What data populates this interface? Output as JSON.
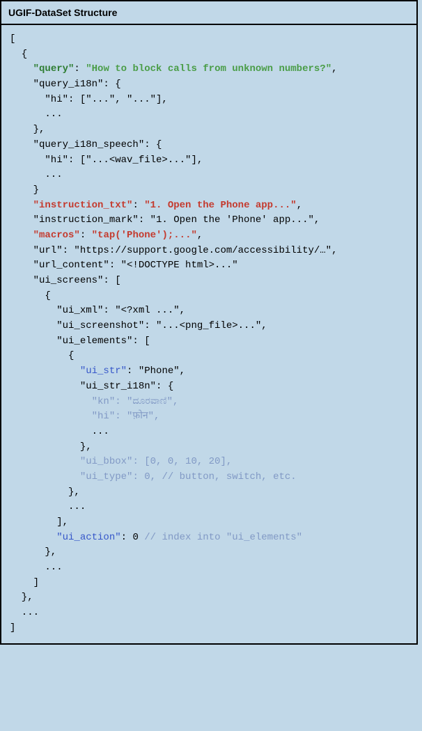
{
  "header": {
    "title": "UGIF-DataSet Structure"
  },
  "code": {
    "l1": "[",
    "l2": "  {",
    "l3a": "    ",
    "l3b": "\"query\"",
    "l3c": ": ",
    "l3d": "\"How to block calls from unknown numbers?\"",
    "l3e": ",",
    "l4": "    \"query_i18n\": {",
    "l5": "      \"hi\": [\"...\", \"...\"],",
    "l6": "      ...",
    "l7": "    },",
    "l8": "    \"query_i18n_speech\": {",
    "l9": "      \"hi\": [\"...<wav_file>...\"],",
    "l10": "      ...",
    "l11": "    }",
    "l12a": "    ",
    "l12b": "\"instruction_txt\"",
    "l12c": ": ",
    "l12d": "\"1. Open the Phone app...\"",
    "l12e": ",",
    "l13": "    \"instruction_mark\": \"1. Open the 'Phone' app...\",",
    "l14a": "    ",
    "l14b": "\"macros\"",
    "l14c": ": ",
    "l14d": "\"tap('Phone');...\"",
    "l14e": ",",
    "l15": "    \"url\": \"https://support.google.com/accessibility/…\",",
    "l16": "    \"url_content\": \"<!DOCTYPE html>...\"",
    "l17": "    \"ui_screens\": [",
    "l18": "      {",
    "l19": "        \"ui_xml\": \"<?xml ...\",",
    "l20": "        \"ui_screenshot\": \"...<png_file>...\",",
    "l21": "        \"ui_elements\": [",
    "l22": "          {",
    "l23a": "            ",
    "l23b": "\"ui_str\"",
    "l23c": ": \"Phone\",",
    "l24": "            \"ui_str_i18n\": {",
    "l25a": "              ",
    "l25b": "\"kn\": \"ದೂರವಾಣಿ\",",
    "l26a": "              ",
    "l26b": "\"hi\": \"फ़ोन\",",
    "l27": "              ...",
    "l28": "            },",
    "l29a": "            ",
    "l29b": "\"ui_bbox\": [0, 0, 10, 20],",
    "l30a": "            ",
    "l30b": "\"ui_type\": 0, // button, switch, etc.",
    "l31": "          },",
    "l32": "          ...",
    "l33": "        ],",
    "l34a": "        ",
    "l34b": "\"ui_action\"",
    "l34c": ": 0 ",
    "l34d": "// index into \"ui_elements\"",
    "l35": "      },",
    "l36": "      ...",
    "l37": "    ]",
    "l38": "  },",
    "l39": "  ...",
    "l40": "]"
  }
}
